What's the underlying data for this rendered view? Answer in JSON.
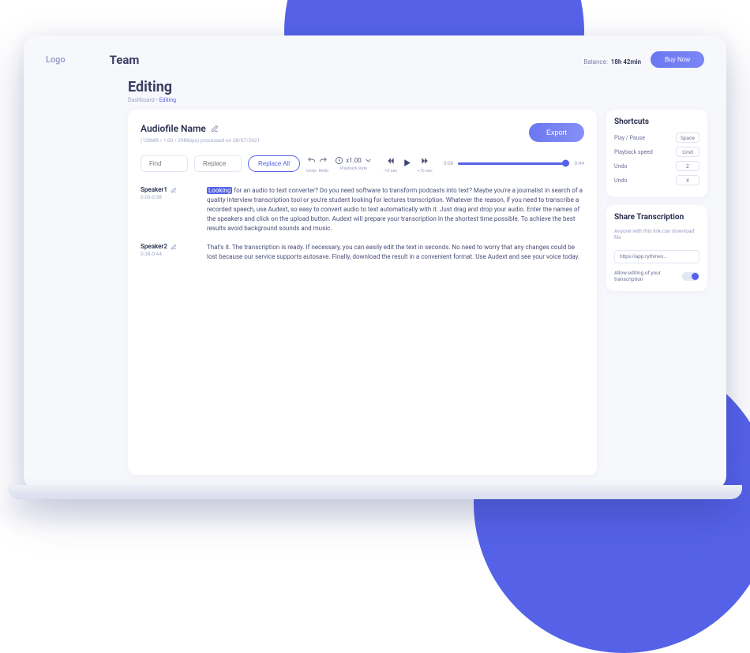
{
  "header": {
    "logo": "Logo",
    "team": "Team",
    "balance_label": "Balance:",
    "balance_value": "18h 42min",
    "buy_now": "Buy Now"
  },
  "page": {
    "title": "Editing",
    "breadcrumb_root": "Dashboard",
    "breadcrumb_sep": "•",
    "breadcrumb_current": "Editing"
  },
  "file": {
    "name": "Audiofile Name",
    "meta": "(128MB / 1:00 / 298kbps) processed on 28/07/2021",
    "export": "Export"
  },
  "toolbar": {
    "find_placeholder": "Find",
    "replace_placeholder": "Replace",
    "replace_all": "Replace All",
    "undo": "Undo",
    "redo": "Redo",
    "playback_rate_label": "Playback Rate",
    "playback_rate_value": "x1.00",
    "back10_label": "-10 sec",
    "fwd10_label": "+10 sec",
    "time_start": "0:00",
    "time_end": "0:44"
  },
  "transcript": [
    {
      "speaker": "Speaker1",
      "time": "0:00-0:38",
      "highlight": "Looking",
      "text": " for an audio to text converter? Do you need software to transform podcasts into text? Maybe you're a journalist in search of a quality interview transcription tool or you're student looking for lectures transcription. Whatever the reason, if you need to transcribe a recorded speech, use Audext, so easy to convert audio to text automatically with it. Just drag and drop your audio. Enter the names of the speakers and click on the upload button. Audext will prepare your transcription in the shortest time possible. To achieve the best results avoid background sounds and music."
    },
    {
      "speaker": "Speaker2",
      "time": "0:38-0:44",
      "highlight": "",
      "text": "That's it. The transcription is ready. If necessary, you can easily edit the text in seconds. No need to worry that any changes could be lost because our service supports autosave. Finally, download the result in a convenient format. Use Audext and see your voice today."
    }
  ],
  "shortcuts": {
    "title": "Shortcuts",
    "rows": [
      {
        "label": "Play / Pause",
        "key": "Space"
      },
      {
        "label": "Playback speed",
        "key": "Cmd"
      },
      {
        "label": "Undo",
        "key": "Z"
      },
      {
        "label": "Undo",
        "key": "X"
      }
    ]
  },
  "share": {
    "title": "Share Transcription",
    "subtitle": "Anyone with this link can download file",
    "link": "https://app.rythmex..",
    "allow_label": "Allow editing of your transcription"
  }
}
